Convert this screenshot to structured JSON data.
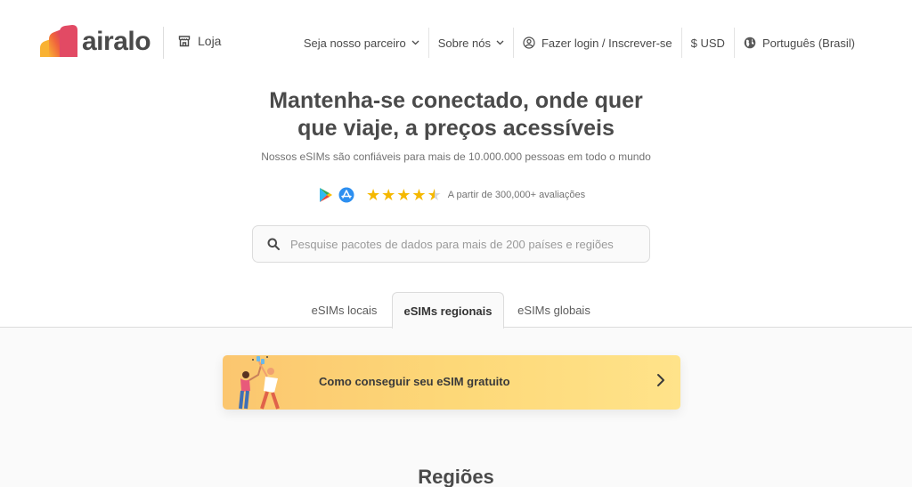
{
  "brand": {
    "name": "airalo"
  },
  "header": {
    "store_label": "Loja",
    "nav": {
      "partner": "Seja nosso parceiro",
      "about": "Sobre nós",
      "login": "Fazer login / Inscrever-se",
      "currency": "$ USD",
      "language": "Português (Brasil)"
    }
  },
  "hero": {
    "title_line1": "Mantenha-se conectado, onde quer",
    "title_line2": "que viaje, a preços acessíveis",
    "subtitle": "Nossos eSIMs são confiáveis para mais de 10.000.000 pessoas em todo o mundo",
    "rating_value": 4.5,
    "rating_text": "A partir de 300,000+ avaliações"
  },
  "search": {
    "placeholder": "Pesquise pacotes de dados para mais de 200 países e regiões",
    "value": ""
  },
  "tabs": [
    {
      "label": "eSIMs locais",
      "active": false
    },
    {
      "label": "eSIMs regionais",
      "active": true
    },
    {
      "label": "eSIMs globais",
      "active": false
    }
  ],
  "promo": {
    "text": "Como conseguir seu eSIM gratuito"
  },
  "section": {
    "title": "Regiões"
  },
  "colors": {
    "brand_orange": "#f7a534",
    "brand_pink": "#e9475f",
    "star": "#f5b800",
    "promo_start": "#fbc66f",
    "promo_end": "#ffe38a"
  }
}
